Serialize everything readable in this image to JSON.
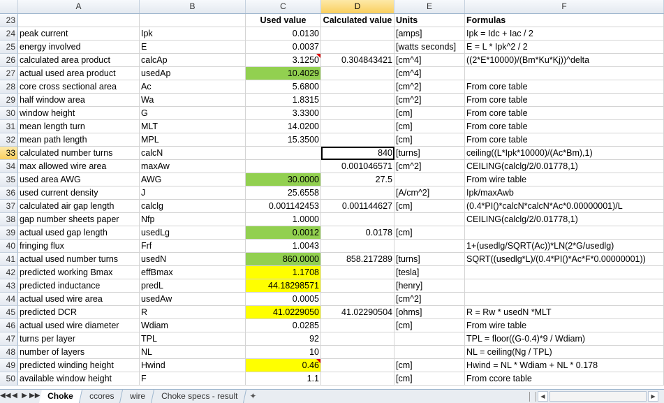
{
  "columns": [
    "",
    "A",
    "B",
    "C",
    "D",
    "E",
    "F"
  ],
  "selected_column": "D",
  "selected_row": "33",
  "header_row": {
    "rownum": "23",
    "a": "",
    "b": "",
    "c": "Used value",
    "d": "Calculated value",
    "e": "Units",
    "f": "Formulas"
  },
  "rows": [
    {
      "rownum": "24",
      "a": "peak current",
      "b": "Ipk",
      "c": "0.0130",
      "d": "",
      "e": "[amps]",
      "f": "Ipk = Idc + Iac / 2"
    },
    {
      "rownum": "25",
      "a": "energy involved",
      "b": "E",
      "c": "0.0037",
      "d": "",
      "e": "[watts seconds]",
      "f": "E = L * Ipk^2 / 2"
    },
    {
      "rownum": "26",
      "a": "calculated area product",
      "b": "calcAp",
      "c": "3.1250",
      "d": "0.304843421",
      "e": "[cm^4]",
      "f": "((2*E*10000)/(Bm*Ku*Kj))^delta"
    },
    {
      "rownum": "27",
      "a": "actual used area product",
      "b": "usedAp",
      "c": "10.4029",
      "d": "",
      "e": "[cm^4]",
      "f": ""
    },
    {
      "rownum": "28",
      "a": "core cross sectional area",
      "b": "Ac",
      "c": "5.6800",
      "d": "",
      "e": "[cm^2]",
      "f": "From core table"
    },
    {
      "rownum": "29",
      "a": "half window area",
      "b": "Wa",
      "c": "1.8315",
      "d": "",
      "e": "[cm^2]",
      "f": "From core table"
    },
    {
      "rownum": "30",
      "a": "window height",
      "b": "G",
      "c": "3.3300",
      "d": "",
      "e": "[cm]",
      "f": "From core table"
    },
    {
      "rownum": "31",
      "a": "mean length turn",
      "b": "MLT",
      "c": "14.0200",
      "d": "",
      "e": "[cm]",
      "f": "From core table"
    },
    {
      "rownum": "32",
      "a": "mean path length",
      "b": "MPL",
      "c": "15.3500",
      "d": "",
      "e": "[cm]",
      "f": "From core table"
    },
    {
      "rownum": "33",
      "a": "calculated number turns",
      "b": "calcN",
      "c": "",
      "d": "840",
      "e": "[turns]",
      "f": "ceiling((L*Ipk*10000)/(Ac*Bm),1)"
    },
    {
      "rownum": "34",
      "a": "max allowed wire area",
      "b": "maxAw",
      "c": "",
      "d": "0.001046571",
      "e": "[cm^2]",
      "f": "CEILING(calclg/2/0.01778,1)"
    },
    {
      "rownum": "35",
      "a": "used area AWG",
      "b": "AWG",
      "c": "30.0000",
      "d": "27.5",
      "e": "",
      "f": "From wire table"
    },
    {
      "rownum": "36",
      "a": "used current density",
      "b": "J",
      "c": "25.6558",
      "d": "",
      "e": "[A/cm^2]",
      "f": "Ipk/maxAwb"
    },
    {
      "rownum": "37",
      "a": "calculated air gap length",
      "b": "calclg",
      "c": "0.001142453",
      "d": "0.001144627",
      "e": "[cm]",
      "f": "(0.4*PI()*calcN*calcN*Ac*0.00000001)/L"
    },
    {
      "rownum": "38",
      "a": "gap number sheets paper",
      "b": "Nfp",
      "c": "1.0000",
      "d": "",
      "e": "",
      "f": "CEILING(calclg/2/0.01778,1)"
    },
    {
      "rownum": "39",
      "a": "actual used gap length",
      "b": "usedLg",
      "c": "0.0012",
      "d": "0.0178",
      "e": "[cm]",
      "f": ""
    },
    {
      "rownum": "40",
      "a": "fringing flux",
      "b": "Frf",
      "c": "1.0043",
      "d": "",
      "e": "",
      "f": "1+(usedlg/SQRT(Ac))*LN(2*G/usedlg)"
    },
    {
      "rownum": "41",
      "a": "actual used number turns",
      "b": "usedN",
      "c": "860.0000",
      "d": "858.217289",
      "e": "[turns]",
      "f": "SQRT((usedlg*L)/(0.4*PI()*Ac*F*0.00000001))"
    },
    {
      "rownum": "42",
      "a": "predicted  working Bmax",
      "b": "effBmax",
      "c": "1.1708",
      "d": "",
      "e": "[tesla]",
      "f": ""
    },
    {
      "rownum": "43",
      "a": "predicted inductance",
      "b": "predL",
      "c": "44.18298571",
      "d": "",
      "e": "[henry]",
      "f": ""
    },
    {
      "rownum": "44",
      "a": "actual used wire area",
      "b": "usedAw",
      "c": "0.0005",
      "d": "",
      "e": "[cm^2]",
      "f": ""
    },
    {
      "rownum": "45",
      "a": "predicted DCR",
      "b": "R",
      "c": "41.0229050",
      "d": "41.02290504",
      "e": "[ohms]",
      "f": "R = Rw * usedN *MLT"
    },
    {
      "rownum": "46",
      "a": "actual used wire diameter",
      "b": "Wdiam",
      "c": "0.0285",
      "d": "",
      "e": "[cm]",
      "f": "From wire table"
    },
    {
      "rownum": "47",
      "a": "turns per layer",
      "b": "TPL",
      "c": "92",
      "d": "",
      "e": "",
      "f": "TPL = floor((G-0.4)*9 / Wdiam)"
    },
    {
      "rownum": "48",
      "a": "number of layers",
      "b": "NL",
      "c": "10",
      "d": "",
      "e": "",
      "f": "NL = ceiling(Ng / TPL)"
    },
    {
      "rownum": "49",
      "a": "predicted winding height",
      "b": "Hwind",
      "c": "0.46",
      "d": "",
      "e": "[cm]",
      "f": "Hwind = NL * Wdiam + NL * 0.178"
    },
    {
      "rownum": "50",
      "a": "available window height",
      "b": "F",
      "c": "1.1",
      "d": "",
      "e": "[cm]",
      "f": "From ccore table"
    }
  ],
  "colors": {
    "green": "#92d050",
    "yellow": "#ffff00"
  },
  "green_rows": [
    "27",
    "35",
    "39",
    "41"
  ],
  "yellow_rows": [
    "42",
    "43",
    "45",
    "49"
  ],
  "tabs": [
    "Choke",
    "ccores",
    "wire",
    "Choke specs - result"
  ],
  "active_tab": "Choke",
  "nav_icons": [
    "first-sheet-icon",
    "prev-sheet-icon",
    "next-sheet-icon",
    "last-sheet-icon"
  ]
}
